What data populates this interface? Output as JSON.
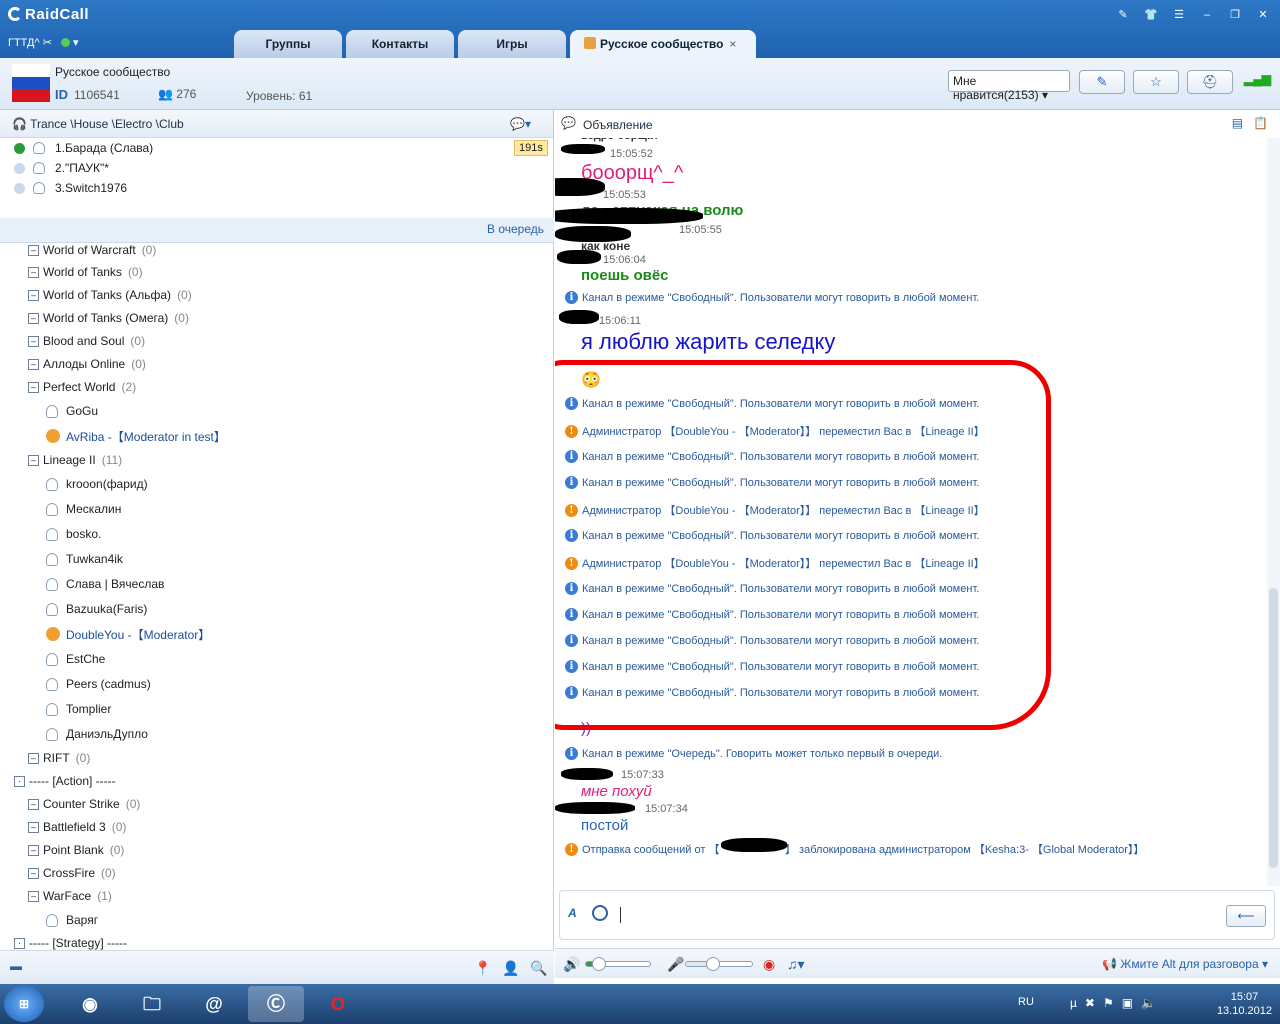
{
  "app": {
    "name": "RaidCall",
    "status": "ГТТД^"
  },
  "tabs": [
    {
      "label": "Группы"
    },
    {
      "label": "Контакты"
    },
    {
      "label": "Игры"
    },
    {
      "label": "Русское сообщество",
      "close": "×"
    }
  ],
  "channel": {
    "name": "Русское сообщество",
    "id_label": "ID",
    "id": "1106541",
    "members": "276",
    "level": "Уровень: 61",
    "likes": "Мне нравится(2153)"
  },
  "left": {
    "header": "Trance \\House \\Electro \\Club",
    "timer": "191s",
    "queue_footer": "В очередь",
    "queue": [
      {
        "label": "1.Барада (Слава)"
      },
      {
        "label": "2.\"ПАУК\"*"
      },
      {
        "label": "3.Switch1976"
      }
    ],
    "tree": [
      {
        "label": "World of Warcraft",
        "count": "(0)"
      },
      {
        "label": "World of Tanks",
        "count": "(0)"
      },
      {
        "label": "World of Tanks (Альфа)",
        "count": "(0)"
      },
      {
        "label": "World of Tanks (Омега)",
        "count": "(0)"
      },
      {
        "label": "Blood and Soul",
        "count": "(0)"
      },
      {
        "label": "Аллоды Online",
        "count": "(0)"
      },
      {
        "label": "Perfect World",
        "count": "(2)"
      },
      {
        "label": "GoGu",
        "count": ""
      },
      {
        "label": "AvRiba -【Moderator in test】",
        "count": ""
      },
      {
        "label": "Lineage II",
        "count": "(11)"
      },
      {
        "label": "krooon(фарид)",
        "count": ""
      },
      {
        "label": "Мескалин",
        "count": ""
      },
      {
        "label": "bosko.",
        "count": ""
      },
      {
        "label": "Tuwkan4ik",
        "count": ""
      },
      {
        "label": "Слава | Вячеслав",
        "count": ""
      },
      {
        "label": "Bazuuka(Faris)",
        "count": ""
      },
      {
        "label": "DoubleYou -【Moderator】",
        "count": ""
      },
      {
        "label": "EstChe",
        "count": ""
      },
      {
        "label": "Peers (cadmus)",
        "count": ""
      },
      {
        "label": "Tomplier",
        "count": ""
      },
      {
        "label": "ДаниэльДупло",
        "count": ""
      },
      {
        "label": "RIFT",
        "count": "(0)"
      },
      {
        "label": "----- [Action] -----",
        "count": ""
      },
      {
        "label": "Counter Strike",
        "count": "(0)"
      },
      {
        "label": "Battlefield 3",
        "count": "(0)"
      },
      {
        "label": "Point Blank",
        "count": "(0)"
      },
      {
        "label": "CrossFire",
        "count": "(0)"
      },
      {
        "label": "WarFace",
        "count": "(1)"
      },
      {
        "label": "Варяг",
        "count": ""
      },
      {
        "label": "----- [Strategy] -----",
        "count": ""
      }
    ]
  },
  "chat": {
    "header": "Объявление",
    "lines": [
      {
        "t": "ведро борща?"
      },
      {
        "t": "15:05:52"
      },
      {
        "t": "бооорщ^_^"
      },
      {
        "t": "15:05:53"
      },
      {
        "t": "да. .отпуская на волю"
      },
      {
        "t": "15:05:55"
      },
      {
        "t": "как коне"
      },
      {
        "t": "15:06:04"
      },
      {
        "t": "поешь овёс"
      },
      {
        "t": "Канал в режиме \"Свободный\". Пользователи могут говорить в любой момент."
      },
      {
        "t": "15:06:11"
      },
      {
        "t": "я люблю жарить селедку"
      },
      {
        "t": "Канал в режиме \"Свободный\". Пользователи могут говорить в любой момент."
      },
      {
        "t": "Администратор 【DoubleYou - 【Moderator】】 переместил Вас в 【Lineage II】"
      },
      {
        "t": "Канал в режиме \"Свободный\". Пользователи могут говорить в любой момент."
      },
      {
        "t": "Канал в режиме \"Свободный\". Пользователи могут говорить в любой момент."
      },
      {
        "t": "Администратор 【DoubleYou - 【Moderator】】 переместил Вас в 【Lineage II】"
      },
      {
        "t": "Канал в режиме \"Свободный\". Пользователи могут говорить в любой момент."
      },
      {
        "t": "Администратор 【DoubleYou - 【Moderator】】 переместил Вас в 【Lineage II】"
      },
      {
        "t": "Канал в режиме \"Свободный\". Пользователи могут говорить в любой момент."
      },
      {
        "t": "Канал в режиме \"Свободный\". Пользователи могут говорить в любой момент."
      },
      {
        "t": "Канал в режиме \"Свободный\". Пользователи могут говорить в любой момент."
      },
      {
        "t": "Канал в режиме \"Свободный\". Пользователи могут говорить в любой момент."
      },
      {
        "t": "Канал в режиме \"Свободный\". Пользователи могут говорить в любой момент."
      },
      {
        "t": "))"
      },
      {
        "t": "Канал в режиме \"Очередь\". Говорить может только первый в очереди."
      },
      {
        "t": "15:07:33"
      },
      {
        "t": "мне похуй"
      },
      {
        "t": "15:07:34"
      },
      {
        "t": "постой"
      },
      {
        "t": "Отправка сообщений от 【"
      },
      {
        "t": "】 заблокирована администратором 【Kesha:3- 【Global Moderator】】"
      }
    ]
  },
  "voice": {
    "ptt_hint": "Жмите Alt для разговора",
    "volume": 0.2,
    "mic": 0.4
  },
  "taskbar": {
    "lang": "RU",
    "time": "15:07",
    "date": "13.10.2012"
  }
}
